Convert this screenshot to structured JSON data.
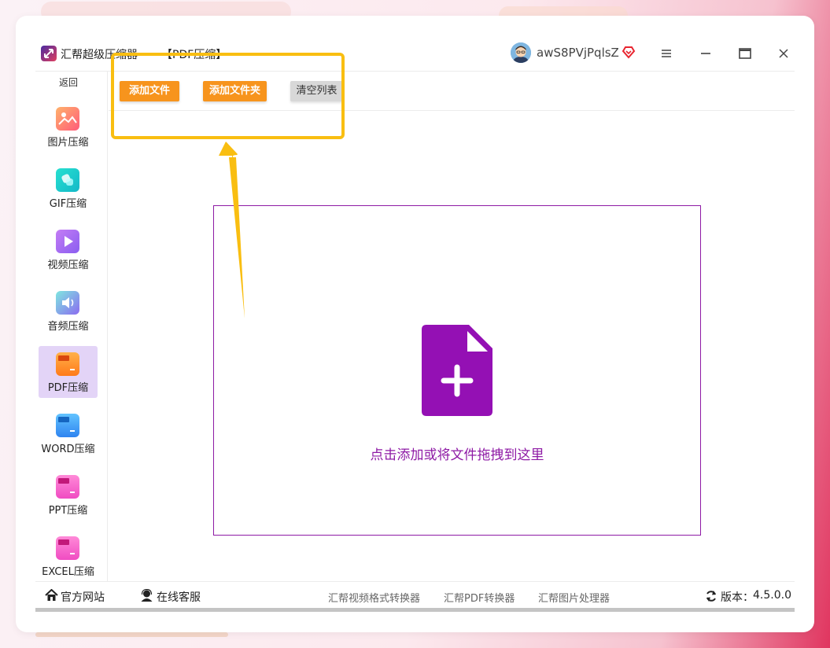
{
  "titlebar": {
    "app_name": "汇帮超级压缩器",
    "mode": "【PDF压缩】",
    "username": "awS8PVjPqlsZ"
  },
  "sidebar": {
    "back_label": "返回",
    "items": [
      {
        "label": "图片压缩",
        "icon": "image-icon"
      },
      {
        "label": "GIF压缩",
        "icon": "gif-icon"
      },
      {
        "label": "视频压缩",
        "icon": "video-icon"
      },
      {
        "label": "音频压缩",
        "icon": "audio-icon"
      },
      {
        "label": "PDF压缩",
        "icon": "pdf-icon",
        "active": true
      },
      {
        "label": "WORD压缩",
        "icon": "word-icon"
      },
      {
        "label": "PPT压缩",
        "icon": "ppt-icon"
      },
      {
        "label": "EXCEL压缩",
        "icon": "excel-icon"
      }
    ]
  },
  "toolbar": {
    "add_file": "添加文件",
    "add_folder": "添加文件夹",
    "clear_list": "清空列表"
  },
  "dropzone": {
    "text": "点击添加或将文件拖拽到这里"
  },
  "bottombar": {
    "website": "官方网站",
    "support": "在线客服",
    "link_video": "汇帮视频格式转换器",
    "link_pdf": "汇帮PDF转换器",
    "link_image": "汇帮图片处理器",
    "version_label": "版本：",
    "version": "4.5.0.0"
  },
  "colors": {
    "accent_orange": "#f7941d",
    "accent_purple": "#8e1aa5",
    "highlight": "#f9be11",
    "active_nav": "#e3d4f7"
  }
}
